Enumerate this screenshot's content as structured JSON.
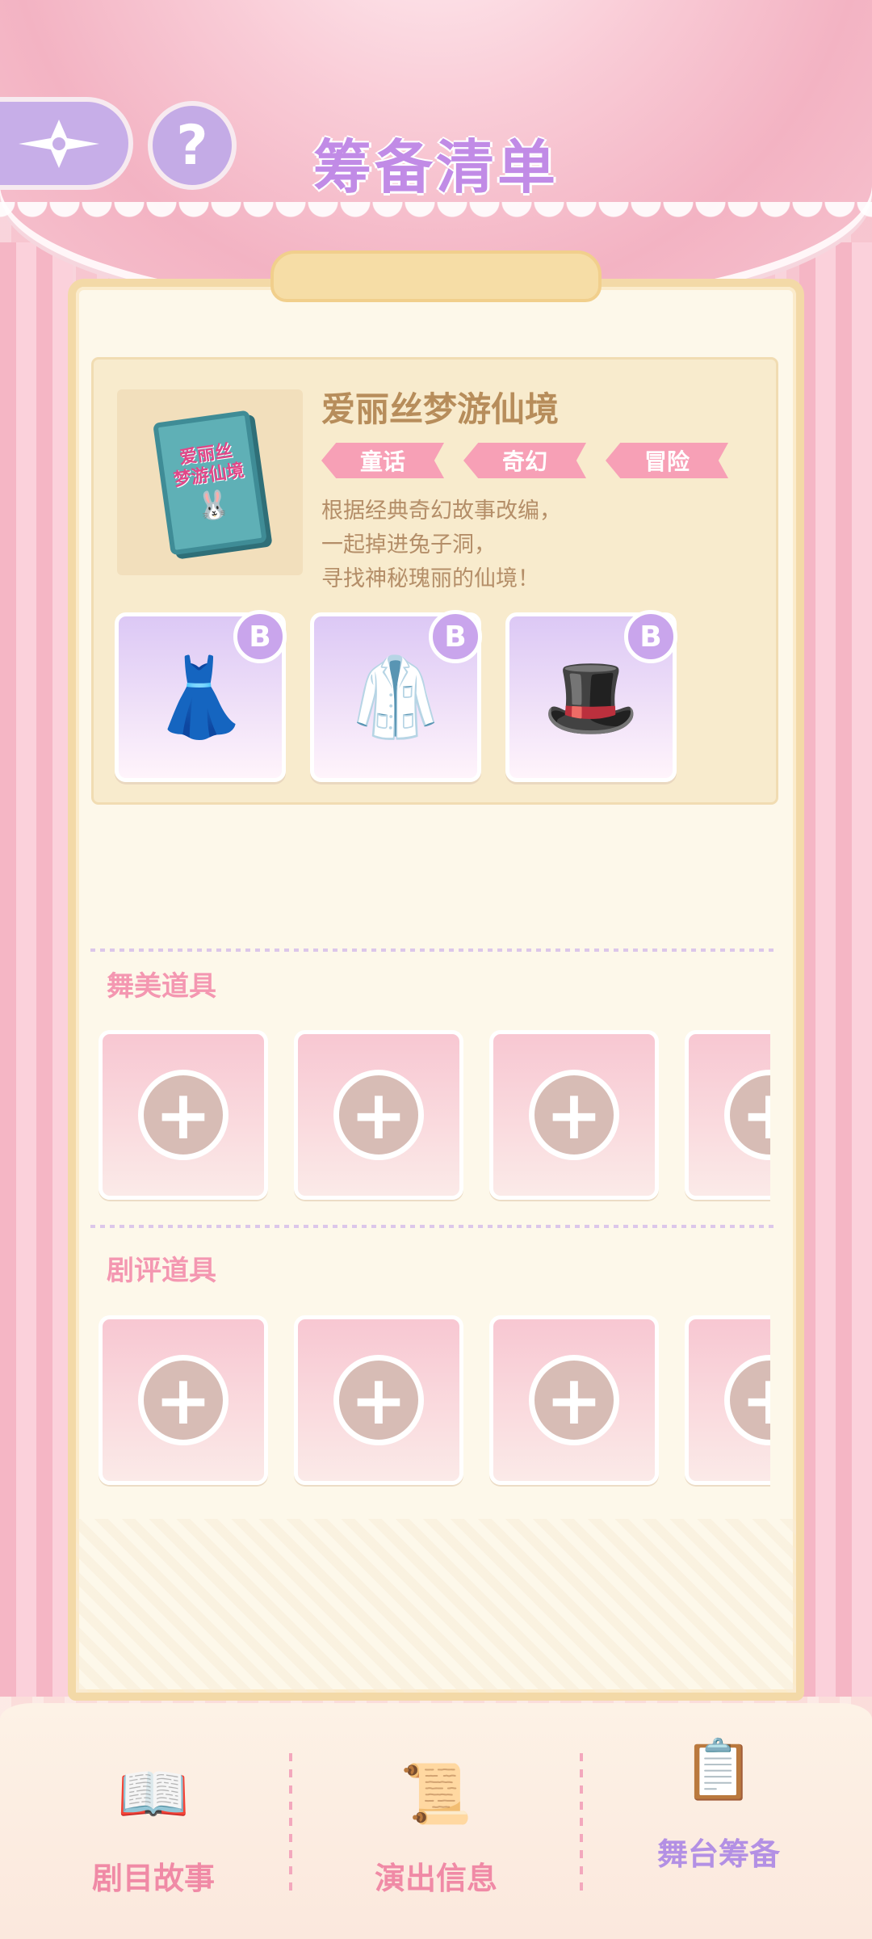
{
  "header": {
    "title": "筹备清单",
    "back_icon": "sparkle-arrow-icon",
    "help_label": "?"
  },
  "script": {
    "name": "爱丽丝梦游仙境",
    "cover_title": "爱丽丝\n梦游仙境",
    "tags": [
      "童话",
      "奇幻",
      "冒险"
    ],
    "description": [
      "根据经典奇幻故事改编，",
      "一起掉进兔子洞，",
      "寻找神秘瑰丽的仙境！"
    ],
    "costumes": [
      {
        "rank": "B",
        "icon": "dress-icon"
      },
      {
        "rank": "B",
        "icon": "suit-icon"
      },
      {
        "rank": "B",
        "icon": "hat-icon"
      }
    ]
  },
  "sections": {
    "stage_props": {
      "title": "舞美道具",
      "slots": 4
    },
    "review_props": {
      "title": "剧评道具",
      "slots": 4
    }
  },
  "nav": [
    {
      "label": "剧目故事",
      "icon": "storybook-icon",
      "active": false
    },
    {
      "label": "演出信息",
      "icon": "poster-board-icon",
      "active": false
    },
    {
      "label": "舞台筹备",
      "icon": "clipboard-icon",
      "active": true
    }
  ],
  "colors": {
    "accent_purple": "#c18be6",
    "tag_pink": "#f7a0b6",
    "section_pink": "#f497b1",
    "panel_gold": "#f3d9a7"
  }
}
